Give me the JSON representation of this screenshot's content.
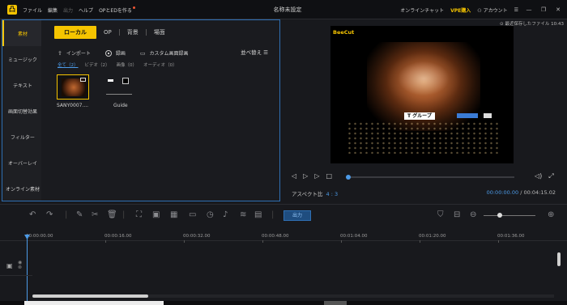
{
  "menu": {
    "items": [
      "ファイル",
      "編集",
      "出力",
      "ヘルプ",
      "OPとEDを作る"
    ],
    "window_title": "名称未設定",
    "online_chat": "オンラインチャット",
    "vpe": "VPE購入",
    "account": "アカウント",
    "window_controls": [
      "—",
      "❐",
      "✕"
    ]
  },
  "saved": "最近保存したファイル 10:43",
  "categories": [
    "素材",
    "ミュージック",
    "テキスト",
    "画面切替効果",
    "フィルター",
    "オーバーレイ",
    "オンライン素材"
  ],
  "tabs": [
    "ローカル",
    "OP",
    "背景",
    "場面"
  ],
  "tools": {
    "import": "インポート",
    "record": "録画",
    "custom": "カスタム画面録画"
  },
  "sort": "並べ替え ☰",
  "filters": [
    "全て（2）",
    "ビデオ（2）",
    "画像（0）",
    "オーディオ（0）"
  ],
  "media": [
    {
      "label": "SANY0007...."
    },
    {
      "label": "Guide"
    }
  ],
  "preview": {
    "logo": "BeeCut",
    "sign": "T グループ"
  },
  "player": {
    "aspect_label": "アスペクト比",
    "aspect_value": "4 : 3",
    "current": "00:00:00.00",
    "total": "/ 00:04:15.02",
    "progress": 0
  },
  "timeline": {
    "export_label": "出力",
    "ticks": [
      "00:00:00.00",
      "00:00:16.00",
      "00:00:32.00",
      "00:00:48.00",
      "00:01:04.00",
      "00:01:20.00",
      "00:01:36.00"
    ]
  }
}
